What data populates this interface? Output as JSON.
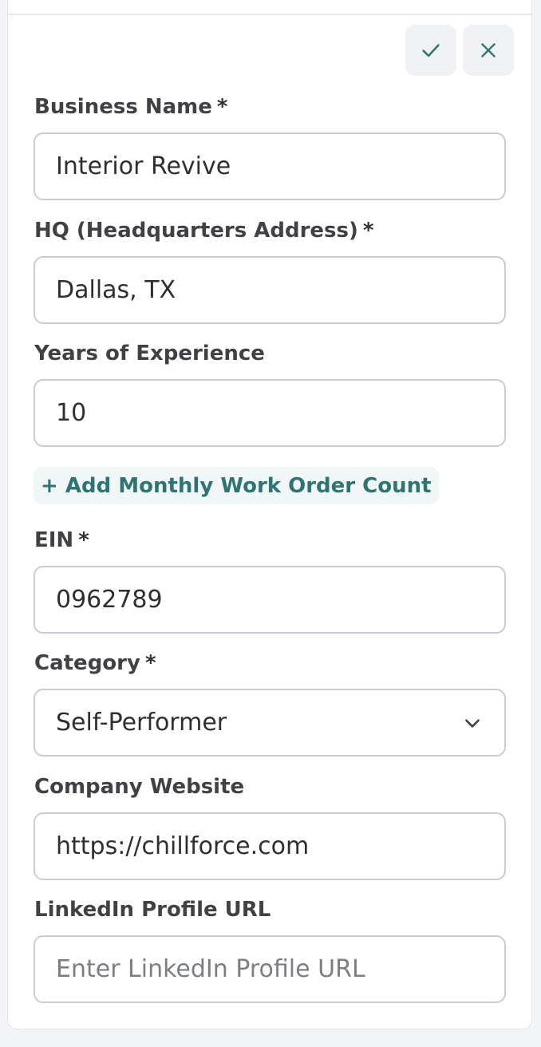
{
  "form": {
    "business_name": {
      "label": "Business Name",
      "required_mark": "*",
      "value": "Interior Revive"
    },
    "hq": {
      "label": "HQ (Headquarters Address)",
      "required_mark": "*",
      "value": "Dallas, TX"
    },
    "years": {
      "label": "Years of Experience",
      "value": "10"
    },
    "add_monthly": {
      "label": "+ Add Monthly Work Order Count"
    },
    "ein": {
      "label": "EIN",
      "required_mark": "*",
      "value": "0962789"
    },
    "category": {
      "label": "Category",
      "required_mark": "*",
      "value": "Self-Performer"
    },
    "website": {
      "label": "Company Website",
      "value": "https://chillforce.com"
    },
    "linkedin": {
      "label": "LinkedIn Profile URL",
      "value": "",
      "placeholder": "Enter LinkedIn Profile URL"
    }
  },
  "actions": {
    "confirm_icon": "check-icon",
    "cancel_icon": "close-icon"
  },
  "colors": {
    "accent": "#2e7472",
    "accent_bg": "#f0f7f6",
    "button_bg": "#eff1f5"
  }
}
